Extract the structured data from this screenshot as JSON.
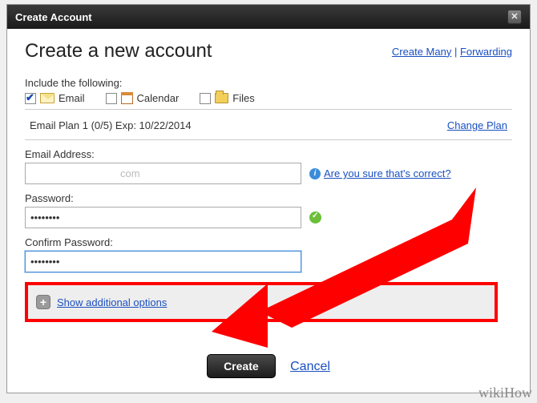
{
  "window": {
    "title": "Create Account"
  },
  "header": {
    "title": "Create a new account",
    "links": {
      "create_many": "Create Many",
      "forwarding": "Forwarding"
    }
  },
  "include": {
    "label": "Include the following:",
    "email": "Email",
    "calendar": "Calendar",
    "files": "Files"
  },
  "plan": {
    "text": "Email Plan 1 (0/5) Exp: 10/22/2014",
    "change": "Change Plan"
  },
  "email": {
    "label": "Email Address:",
    "value": "                               com",
    "hint": "Are you sure that's correct?"
  },
  "password": {
    "label": "Password:",
    "value": "••••••••"
  },
  "confirm": {
    "label": "Confirm Password:",
    "value": "••••••••"
  },
  "options": {
    "show": "Show additional options"
  },
  "footer": {
    "create": "Create",
    "cancel": "Cancel"
  },
  "watermark": "wikiHow"
}
